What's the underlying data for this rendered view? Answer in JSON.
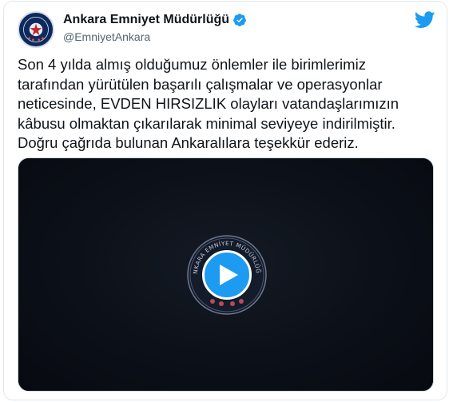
{
  "account": {
    "name": "Ankara Emniyet Müdürlüğü",
    "handle": "@EmniyetAnkara",
    "verified_icon": "verified-badge-icon",
    "avatar_icon": "police-emblem-icon"
  },
  "brand": {
    "logo_icon": "twitter-bird-icon",
    "color": "#1d9bf0"
  },
  "tweet": {
    "text": "Son 4 yılda almış olduğumuz önlemler ile birimlerimiz\ntarafından yürütülen başarılı çalışmalar ve operasyonlar\nneticesinde, EVDEN HIRSIZLIK olayları vatandaşlarımızın\nkâbusu olmaktan çıkarılarak minimal seviyeye indirilmiştir.\nDoğru çağrıda bulunan Ankaralılara teşekkür ederiz."
  },
  "video": {
    "emblem_text": "ANKARA EMNİYET MÜDÜRLÜĞÜ",
    "play_icon": "play-icon",
    "background_color": "#0a0d14"
  }
}
